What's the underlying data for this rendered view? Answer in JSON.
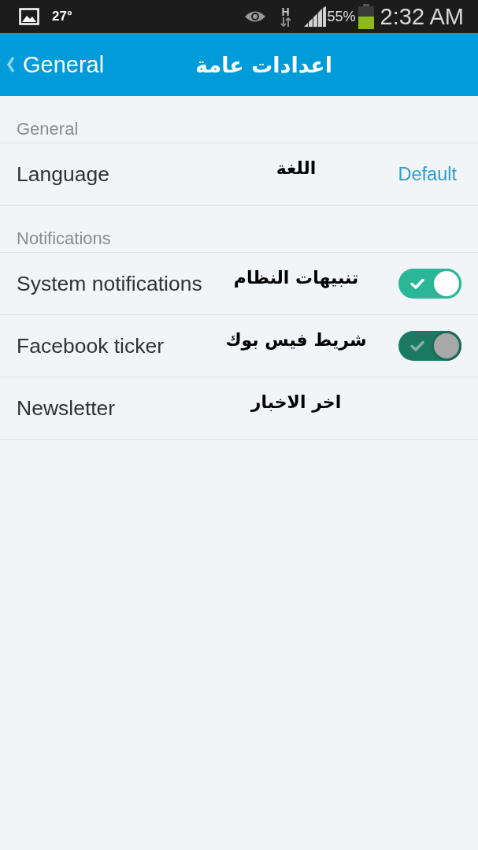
{
  "status_bar": {
    "temperature": "27°",
    "network": "H",
    "battery": "55%",
    "time": "2:32 AM"
  },
  "header": {
    "back_label": "General",
    "title": "اعدادات عامة"
  },
  "sections": [
    {
      "title": "General",
      "rows": [
        {
          "kind": "value",
          "label": "Language",
          "annotation": "اللغة",
          "value": "Default"
        }
      ]
    },
    {
      "title": "Notifications",
      "rows": [
        {
          "kind": "toggle",
          "label": "System notifications",
          "annotation": "تنبيهات النظام",
          "on": true,
          "disabled": false
        },
        {
          "kind": "toggle",
          "label": "Facebook ticker",
          "annotation": "شريط فيس بوك",
          "on": true,
          "disabled": true
        },
        {
          "kind": "plain",
          "label": "Newsletter",
          "annotation": "اخر الاخبار"
        }
      ]
    }
  ]
}
